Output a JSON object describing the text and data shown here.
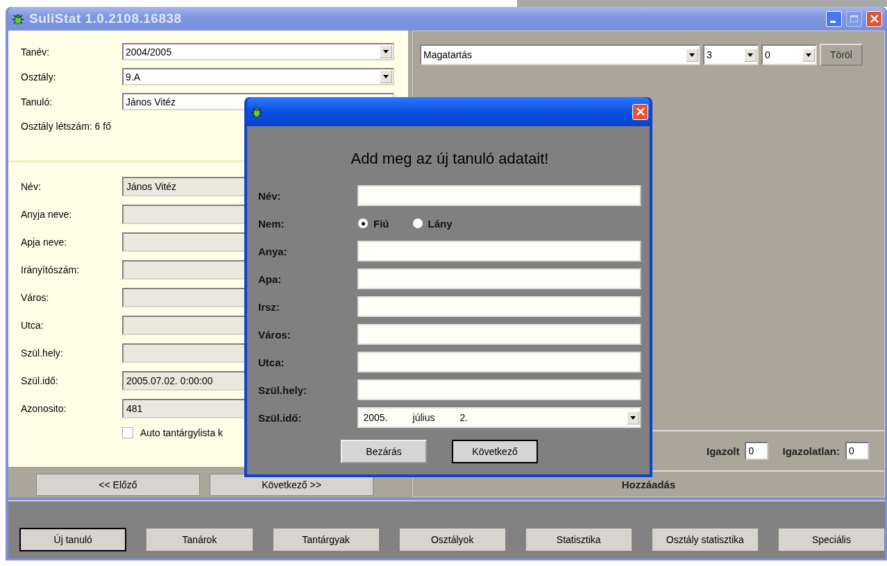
{
  "window": {
    "title": "SuliStat 1.0.2108.16838"
  },
  "selection": [
    {
      "label": "Tanév:",
      "value": "2004/2005",
      "kind": "dropdown"
    },
    {
      "label": "Osztály:",
      "value": "9.A",
      "kind": "dropdown"
    },
    {
      "label": "Tanuló:",
      "value": "János Vitéz",
      "kind": "text"
    }
  ],
  "class_size": "Osztály létszám: 6 fő",
  "student": [
    {
      "label": "Név:",
      "value": "János Vitéz"
    },
    {
      "label": "Anyja neve:"
    },
    {
      "label": "Apja neve:"
    },
    {
      "label": "Irányítószám:"
    },
    {
      "label": "Város:"
    },
    {
      "label": "Utca:"
    },
    {
      "label": "Szül.hely:"
    },
    {
      "label": "Szül.idő:",
      "value": "2005.07.02. 0:00:00"
    },
    {
      "label": "Azonosito:",
      "value": "481"
    }
  ],
  "auto_checkbox": {
    "label": "Auto tantárgylista k",
    "checked": false
  },
  "nav_buttons": [
    "<< Előző",
    "Következő >>"
  ],
  "grade_row": {
    "subject": "Magatartás",
    "grade": "3",
    "count": "0",
    "delete_button": "Töröl"
  },
  "absence": {
    "excused_label": "Igazolt",
    "excused": "0",
    "unexcused_label": "Igazolatlan:",
    "unexcused": "0"
  },
  "add_button": "Hozzáadás",
  "bottom_buttons": [
    {
      "label": "Új tanuló",
      "focused": true
    },
    {
      "label": "Tanárok",
      "focused": false
    },
    {
      "label": "Tantárgyak",
      "focused": false
    },
    {
      "label": "Osztályok",
      "focused": false
    },
    {
      "label": "Statisztika",
      "focused": false
    },
    {
      "label": "Osztály statisztika",
      "focused": false
    },
    {
      "label": "Speciális",
      "focused": false
    }
  ],
  "dialog": {
    "heading": "Add meg az új tanuló adatait!",
    "fields": [
      {
        "label": "Név:",
        "kind": "text"
      },
      {
        "label": "Nem:",
        "kind": "radio",
        "options": [
          {
            "label": "Fiú",
            "selected": true
          },
          {
            "label": "Lány",
            "selected": false
          }
        ]
      },
      {
        "label": "Anya:",
        "kind": "text"
      },
      {
        "label": "Apa:",
        "kind": "text"
      },
      {
        "label": "Irsz:",
        "kind": "text"
      },
      {
        "label": "Város:",
        "kind": "text"
      },
      {
        "label": "Utca:",
        "kind": "text"
      },
      {
        "label": "Szül.hely:",
        "kind": "text"
      },
      {
        "label": "Szül.idő:",
        "kind": "date",
        "parts": [
          "2005.",
          "július",
          "2."
        ]
      }
    ],
    "buttons": [
      {
        "label": "Bezárás",
        "focused": false
      },
      {
        "label": "Következő",
        "focused": true
      }
    ]
  }
}
